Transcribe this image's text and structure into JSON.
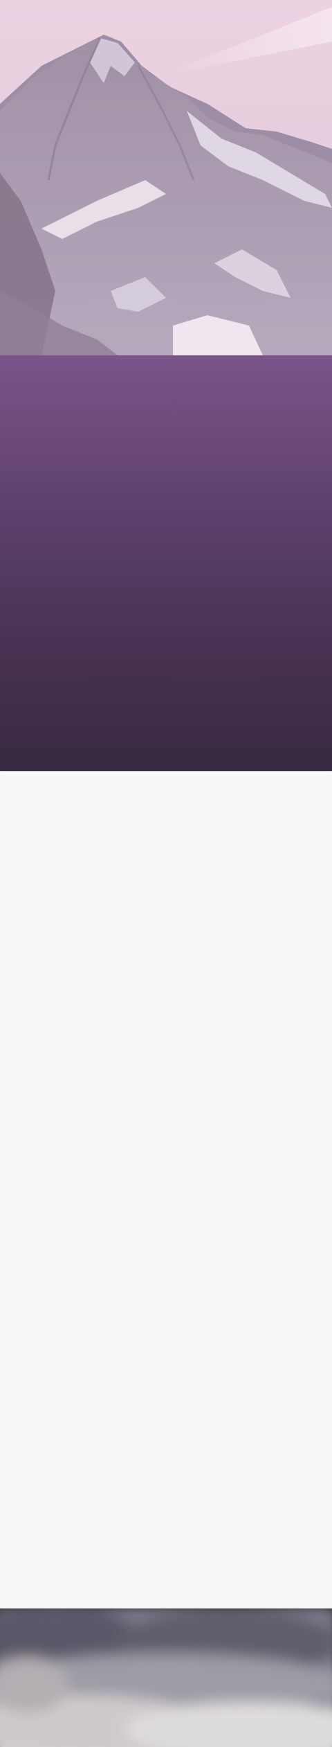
{
  "hero": {
    "image": "snowy-mountain-peak-photo",
    "tint": "#e6cfe0"
  },
  "band": {
    "colors": {
      "top": "#7a548a",
      "bottom": "#382a42"
    }
  },
  "content": {},
  "footer": {
    "image": "blurred-mountain-photo"
  }
}
